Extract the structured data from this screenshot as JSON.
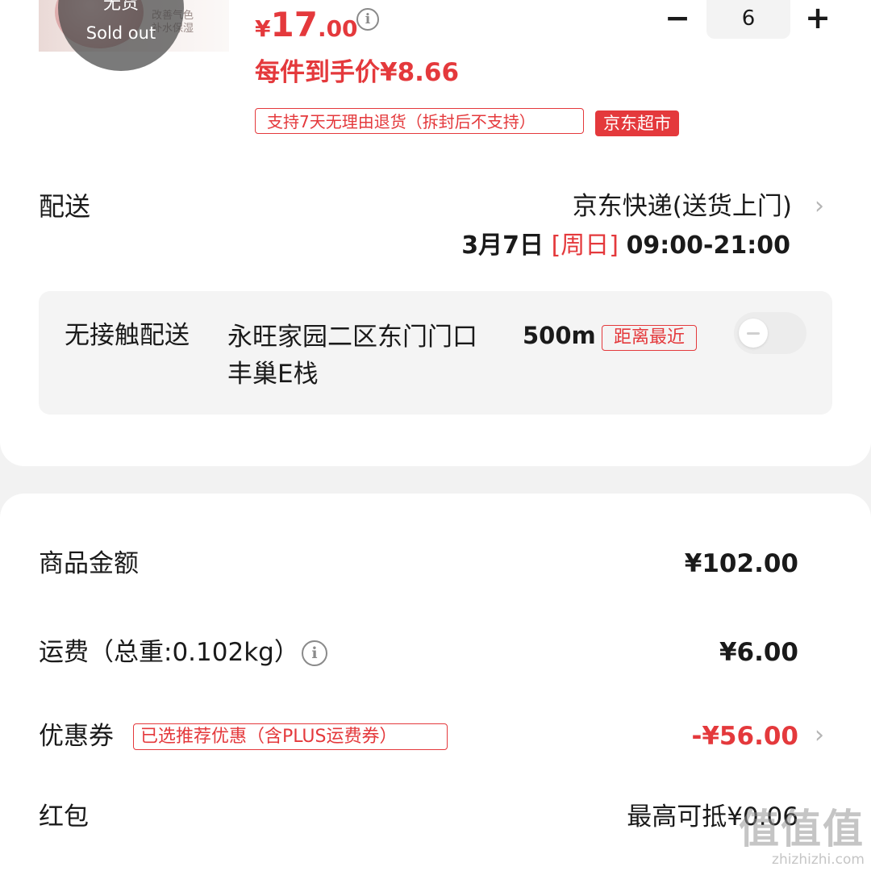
{
  "product": {
    "thumb_text_line1": "改善气色",
    "thumb_text_line2": "补水保湿",
    "sold_out_cn": "无货",
    "sold_out_en": "Sold out",
    "price_symbol": "¥",
    "price_integer": "17",
    "price_decimal": ".00",
    "quantity": "6",
    "minus_label": "−",
    "plus_label": "+",
    "unit_price_text": "每件到手价¥8.66",
    "return_policy": "支持7天无理由退货（拆封后不支持）",
    "store_tag": "京东超市"
  },
  "delivery": {
    "label": "配送",
    "method": "京东快递(送货上门)",
    "date": "3月7日",
    "day": "[周日]",
    "hours": "09:00-21:00"
  },
  "contactless": {
    "label": "无接触配送",
    "address": "永旺家园二区东门门口　　　　　　　丰巢E栈",
    "distance": "500m",
    "nearest_tag": "距离最近",
    "enabled": false
  },
  "summary": {
    "goods_label": "商品金额",
    "goods_value": "¥102.00",
    "shipping_label": "运费（总重:0.102kg）",
    "shipping_value": "¥6.00",
    "coupon_label": "优惠券",
    "coupon_tag": "已选推荐优惠（含PLUS运费券）",
    "coupon_value": "-¥56.00",
    "redpacket_label": "红包",
    "redpacket_value": "最高可抵¥0.06"
  },
  "watermark": {
    "logo": "值值值",
    "site": "zhizhizhi.com"
  },
  "colors": {
    "accent": "#e4393c",
    "background": "#f2f2f2",
    "card": "#ffffff"
  }
}
